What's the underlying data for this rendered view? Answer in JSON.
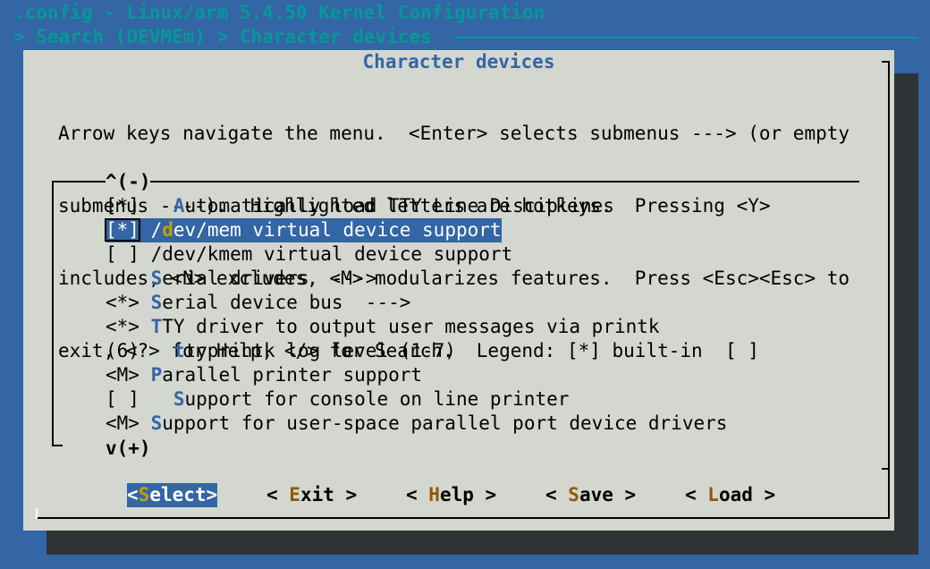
{
  "header": {
    "title": ".config - Linux/arm 5.4.50 Kernel Configuration",
    "breadcrumb": "> Search (DEVMEm) > Character devices"
  },
  "dialog": {
    "title": "Character devices",
    "help_lines": [
      "Arrow keys navigate the menu.  <Enter> selects submenus ---> (or empty",
      "submenus ----).  Highlighted letters are hotkeys.  Pressing <Y>",
      "includes, <N> excludes, <M> modularizes features.  Press <Esc><Esc> to",
      "exit, <?> for Help, </> for Search.  Legend: [*] built-in  [ ]"
    ],
    "scroll_up": "^(-)",
    "scroll_down": "v(+)"
  },
  "menu": {
    "items": [
      {
        "prefix": "[*]   ",
        "hotkey": "A",
        "rest": "utomatically load TTY Line Disciplines"
      },
      {
        "prefix": "[*] /",
        "hotkey": "d",
        "rest": "ev/mem virtual device support"
      },
      {
        "prefix": "[ ] /dev/kmem virtual device support",
        "hotkey": "",
        "rest": ""
      },
      {
        "prefix": "    ",
        "hotkey": "S",
        "rest": "erial drivers  --->"
      },
      {
        "prefix": "<*> ",
        "hotkey": "S",
        "rest": "erial device bus  --->"
      },
      {
        "prefix": "<*> ",
        "hotkey": "T",
        "rest": "TY driver to output user messages via printk"
      },
      {
        "prefix": "(6)   ",
        "hotkey": "t",
        "rest": "typrintk log level (1-7)"
      },
      {
        "prefix": "<M> ",
        "hotkey": "P",
        "rest": "arallel printer support"
      },
      {
        "prefix": "[ ]   ",
        "hotkey": "S",
        "rest": "upport for console on line printer"
      },
      {
        "prefix": "<M> ",
        "hotkey": "S",
        "rest": "upport for user-space parallel port device drivers"
      }
    ],
    "selected_index": 1
  },
  "buttons": [
    {
      "pre": "<",
      "hotkey": "S",
      "post": "elect>"
    },
    {
      "pre": "< ",
      "hotkey": "E",
      "post": "xit >"
    },
    {
      "pre": "< ",
      "hotkey": "H",
      "post": "elp >"
    },
    {
      "pre": "< ",
      "hotkey": "S",
      "post": "ave >"
    },
    {
      "pre": "< ",
      "hotkey": "L",
      "post": "oad >"
    }
  ],
  "colors": {
    "background": "#3465a4",
    "dialog": "#d3d7cf",
    "shadow": "#2e3436",
    "header_text": "#06989a",
    "hotkey": "#3465a4",
    "selection": "#3465a4",
    "selected_hotkey": "#c4a000",
    "button_hotkey": "#8f5902"
  }
}
